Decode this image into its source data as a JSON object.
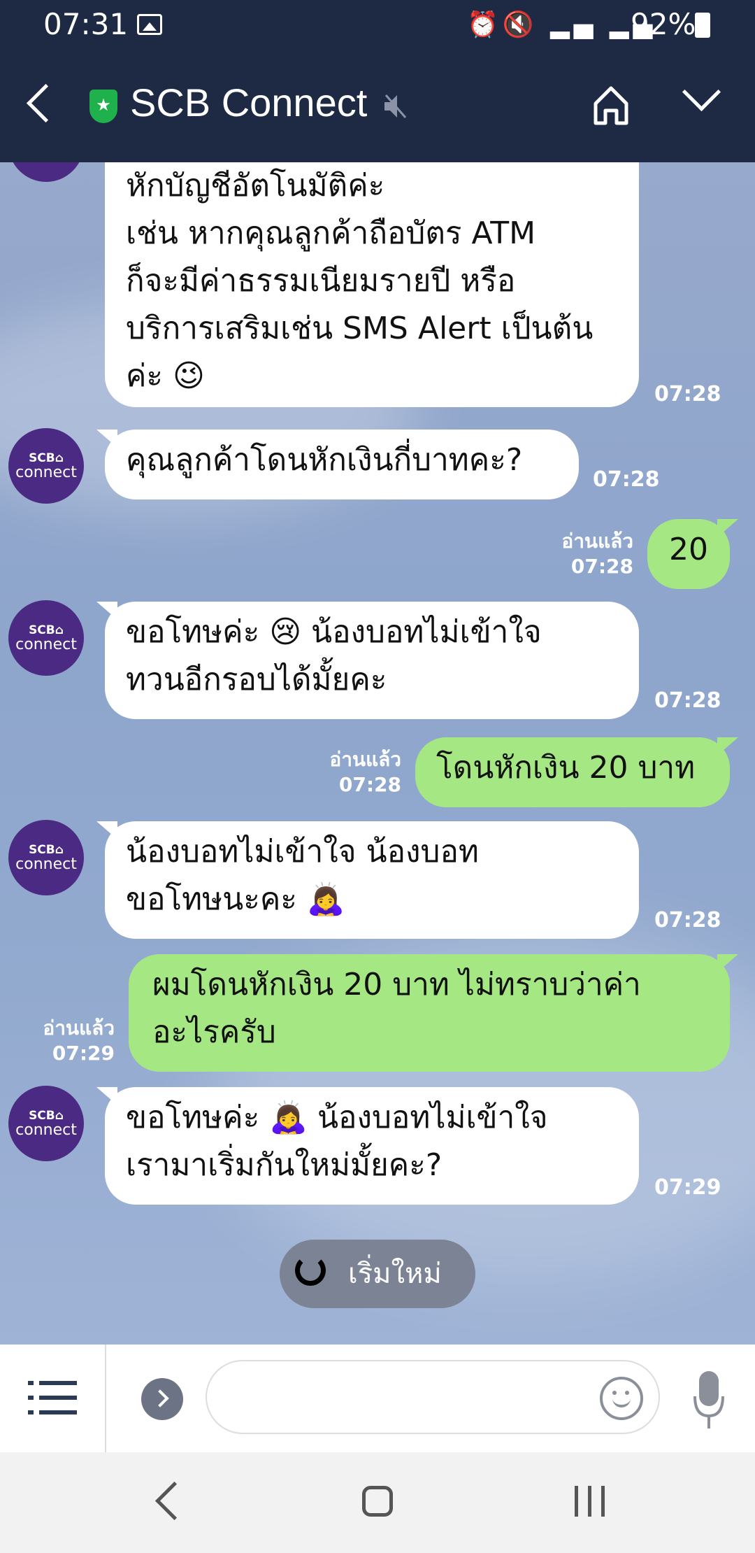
{
  "status_bar": {
    "time": "07:31",
    "battery_pct": "92%",
    "icons": [
      "image-icon",
      "alarm-icon",
      "mute-icon",
      "4g-icon",
      "signal-icon",
      "signal-icon",
      "battery-icon"
    ]
  },
  "header": {
    "title": "SCB Connect",
    "icons": [
      "back-icon",
      "shield-star-icon",
      "mute-icon",
      "home-icon",
      "chevron-down-icon"
    ]
  },
  "avatar": {
    "line1": "SCB⌂",
    "line2": "connect",
    "color": "#4a2a82"
  },
  "messages": [
    {
      "side": "in",
      "text": "หักบัญชีอัตโนมัติค่ะ\nเช่น หากคุณลูกค้าถือบัตร ATM\nก็จะมีค่าธรรมเนียมรายปี หรือ\nบริการเสริมเช่น SMS Alert เป็นต้น\nค่ะ 😉",
      "time": "07:28"
    },
    {
      "side": "in",
      "text": "คุณลูกค้าโดนหักเงินกี่บาทคะ?",
      "time": "07:28"
    },
    {
      "side": "out",
      "text": "20",
      "read": "อ่านแล้ว",
      "time": "07:28"
    },
    {
      "side": "in",
      "text": "ขอโทษค่ะ 😢 น้องบอทไม่เข้าใจ\nทวนอีกรอบได้มั้ยคะ",
      "time": "07:28"
    },
    {
      "side": "out",
      "text": "โดนหักเงิน 20 บาท",
      "read": "อ่านแล้ว",
      "time": "07:28"
    },
    {
      "side": "in",
      "text": "น้องบอทไม่เข้าใจ น้องบอท\nขอโทษนะคะ 🙇‍♀️",
      "time": "07:28"
    },
    {
      "side": "out",
      "text": "ผมโดนหักเงิน 20 บาท ไม่ทราบว่าค่า\nอะไรครับ",
      "read": "อ่านแล้ว",
      "time": "07:29"
    },
    {
      "side": "in",
      "text": "ขอโทษค่ะ 🙇‍♀️ น้องบอทไม่เข้าใจ\nเรามาเริ่มกันใหม่มั้ยคะ?",
      "time": "07:29"
    }
  ],
  "restart_button": {
    "label": "เริ่มใหม่"
  },
  "input_bar": {
    "placeholder": ""
  },
  "colors": {
    "header_bg": "#1e2a44",
    "bubble_out": "#a5e883",
    "bubble_in": "#ffffff",
    "shield": "#1fb14b"
  }
}
